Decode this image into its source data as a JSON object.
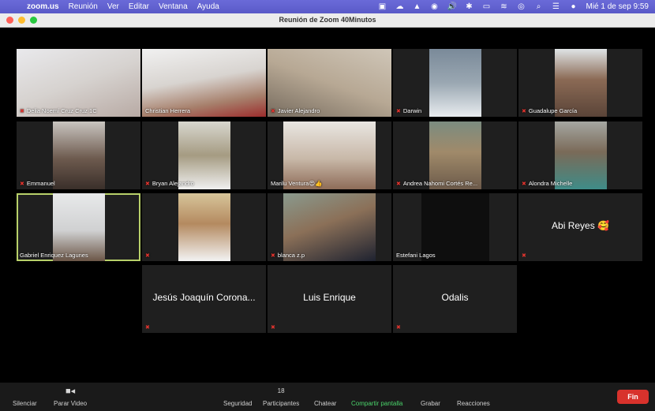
{
  "menubar": {
    "app": "zoom.us",
    "items": [
      "Reunión",
      "Ver",
      "Editar",
      "Ventana",
      "Ayuda"
    ],
    "clock": "Mié 1 de sep  9:59"
  },
  "window": {
    "title": "Reunión de Zoom  40Minutos"
  },
  "participants": [
    {
      "name": "Delia Noemí Cruz Cruz 1C",
      "muted": true
    },
    {
      "name": "Christian Herrera",
      "muted": false
    },
    {
      "name": "Javier Alejandro",
      "muted": true
    },
    {
      "name": "Darwin",
      "muted": true
    },
    {
      "name": "Guadalupe García",
      "muted": true
    },
    {
      "name": "Emmanuel",
      "muted": true
    },
    {
      "name": "Bryan Alejandro",
      "muted": true
    },
    {
      "name": "Marilu Ventura😍👍",
      "muted": false
    },
    {
      "name": "Andrea Nahomi Cortés Re...",
      "muted": true
    },
    {
      "name": "Alondra Michelle",
      "muted": true
    },
    {
      "name": "Gabriel Enriquez Lagunes",
      "muted": false
    },
    {
      "name": "",
      "muted": true
    },
    {
      "name": "blanca z.p",
      "muted": true
    },
    {
      "name": "Estefani Lagos",
      "muted": false
    },
    {
      "name": "Abi Reyes 🥰",
      "muted": true
    },
    {
      "name": "Jesús Joaquín Corona...",
      "muted": true
    },
    {
      "name": "Luis Enrique",
      "muted": true
    },
    {
      "name": "Odalis",
      "muted": true
    }
  ],
  "toolbar": {
    "mute": "Silenciar",
    "stop_video": "Parar Video",
    "security": "Seguridad",
    "participants": "Participantes",
    "participants_count": "18",
    "chat": "Chatear",
    "share": "Compartir pantalla",
    "record": "Grabar",
    "reactions": "Reacciones",
    "end": "Fin"
  },
  "colors": {
    "menubar": "#5a5ac8",
    "active_speaker": "#b8d06a",
    "share_green": "#4ad36a",
    "end_red": "#d8322c",
    "muted_red": "#e0342e"
  }
}
